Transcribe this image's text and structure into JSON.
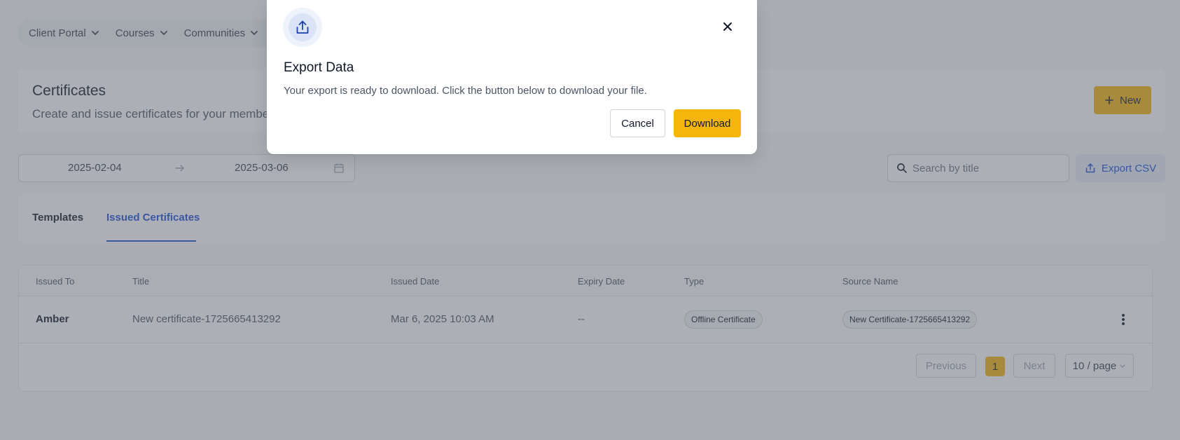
{
  "nav": {
    "items": [
      {
        "label": "Client Portal"
      },
      {
        "label": "Courses"
      },
      {
        "label": "Communities"
      }
    ]
  },
  "header": {
    "title": "Certificates",
    "subtitle": "Create and issue certificates for your members",
    "new_label": "New"
  },
  "filters": {
    "date_start": "2025-02-04",
    "date_end": "2025-03-06",
    "search_placeholder": "Search by title",
    "export_label": "Export CSV"
  },
  "tabs": [
    {
      "label": "Templates",
      "active": false
    },
    {
      "label": "Issued Certificates",
      "active": true
    }
  ],
  "table": {
    "columns": [
      "Issued To",
      "Title",
      "Issued Date",
      "Expiry Date",
      "Type",
      "Source Name"
    ],
    "rows": [
      {
        "issued_to": "Amber",
        "title": "New certificate-1725665413292",
        "issued_date": "Mar 6, 2025 10:03 AM",
        "expiry_date": "--",
        "type": "Offline Certificate",
        "source_name": "New Certificate-1725665413292"
      }
    ]
  },
  "pagination": {
    "previous": "Previous",
    "current": "1",
    "next": "Next",
    "page_size": "10 / page"
  },
  "modal": {
    "title": "Export Data",
    "message": "Your export is ready to download. Click the button below to download your file.",
    "cancel_label": "Cancel",
    "download_label": "Download"
  },
  "colors": {
    "accent": "#f5b50a",
    "link": "#1d4ed8",
    "overlay": "rgba(90, 96, 108, 0.5)"
  },
  "icons": [
    "chevron-down-icon",
    "plus-icon",
    "arrow-right-icon",
    "calendar-icon",
    "search-icon",
    "export-icon",
    "upload-icon",
    "close-icon",
    "more-vertical-icon"
  ]
}
